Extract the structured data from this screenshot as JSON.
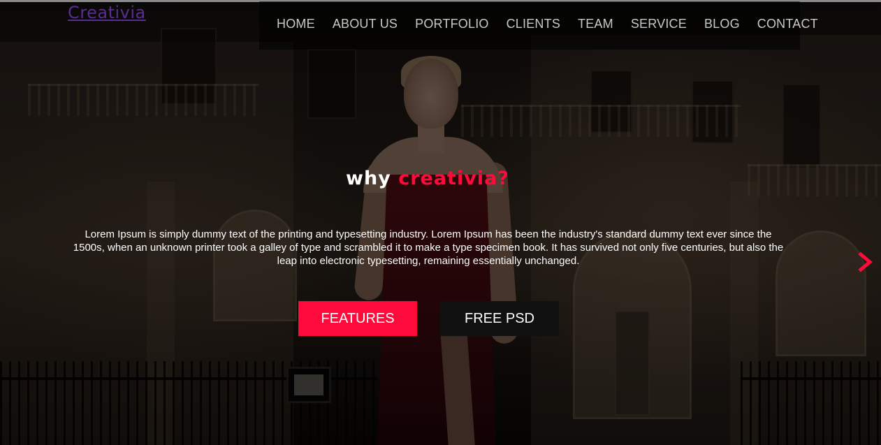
{
  "header": {
    "logo": "Creativia",
    "nav": [
      "HOME",
      "ABOUT US",
      "PORTFOLIO",
      "CLIENTS",
      "TEAM",
      "SERVICE",
      "BLOG",
      "CONTACT"
    ]
  },
  "hero": {
    "headline_part1": "why",
    "headline_part2": "creativia?",
    "intro": "Lorem Ipsum is simply dummy text of the printing and typesetting industry. Lorem Ipsum has been the industry's standard dummy text ever since the 1500s, when an unknown printer took a galley of type and scrambled it to make a type specimen book. It has survived not only five centuries, but also the leap into electronic typesetting, remaining essentially unchanged.",
    "primary_button": "FEATURES",
    "secondary_button": "FREE PSD",
    "next_icon": "chevron-right-icon"
  },
  "colors": {
    "accent": "#ff0a3b",
    "logo": "#5b2c8f",
    "nav_text": "#c9c9c9",
    "dark_button": "#111111"
  }
}
